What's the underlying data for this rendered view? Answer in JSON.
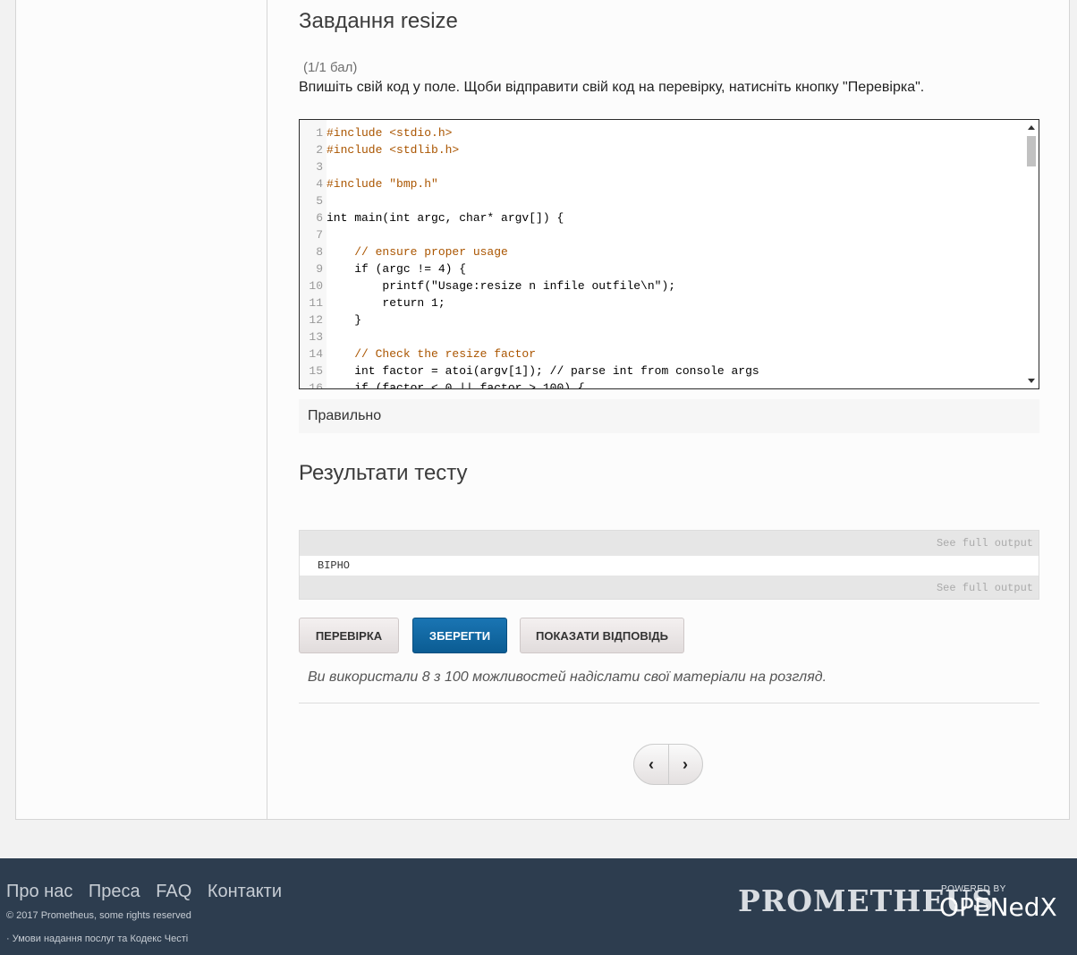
{
  "problem": {
    "title": "Завдання resize",
    "points": "(1/1 бал)",
    "prompt": "Впишіть свій код у поле. Щоби відправити свій код на перевірку, натисніть кнопку \"Перевірка\"."
  },
  "editor": {
    "lines": [
      {
        "n": "1",
        "text": "#include <stdio.h>"
      },
      {
        "n": "2",
        "text": "#include <stdlib.h>"
      },
      {
        "n": "3",
        "text": ""
      },
      {
        "n": "4",
        "text": "#include \"bmp.h\""
      },
      {
        "n": "5",
        "text": ""
      },
      {
        "n": "6",
        "text": "int main(int argc, char* argv[]) {"
      },
      {
        "n": "7",
        "text": ""
      },
      {
        "n": "8",
        "text": "    // ensure proper usage"
      },
      {
        "n": "9",
        "text": "    if (argc != 4) {"
      },
      {
        "n": "10",
        "text": "        printf(\"Usage:resize n infile outfile\\n\");"
      },
      {
        "n": "11",
        "text": "        return 1;"
      },
      {
        "n": "12",
        "text": "    }"
      },
      {
        "n": "13",
        "text": ""
      },
      {
        "n": "14",
        "text": "    // Check the resize factor"
      },
      {
        "n": "15",
        "text": "    int factor = atoi(argv[1]); // parse int from console args"
      },
      {
        "n": "16",
        "text": "    if (factor < 0 || factor > 100) {"
      }
    ]
  },
  "status": "Правильно",
  "results": {
    "title": "Результати тесту",
    "full_output_top": "See full output",
    "row": "ВІРНО",
    "full_output_bottom": "See full output"
  },
  "buttons": {
    "check": "ПЕРЕВІРКА",
    "save": "ЗБЕРЕГТИ",
    "show_answer": "ПОКАЗАТИ ВІДПОВІДЬ"
  },
  "attempts": "Ви використали 8 з 100 можливостей надіслати свої матеріали на розгляд.",
  "pager": {
    "prev": "‹",
    "next": "›"
  },
  "footer": {
    "nav": [
      "Про нас",
      "Преса",
      "FAQ",
      "Контакти"
    ],
    "copyright": "© 2017 Prometheus, some rights reserved",
    "terms": "· Умови надання послуг та Кодекс Честі",
    "brand": "PROMETHEUS",
    "powered": "POWERED BY",
    "edx": "OPENedX"
  }
}
